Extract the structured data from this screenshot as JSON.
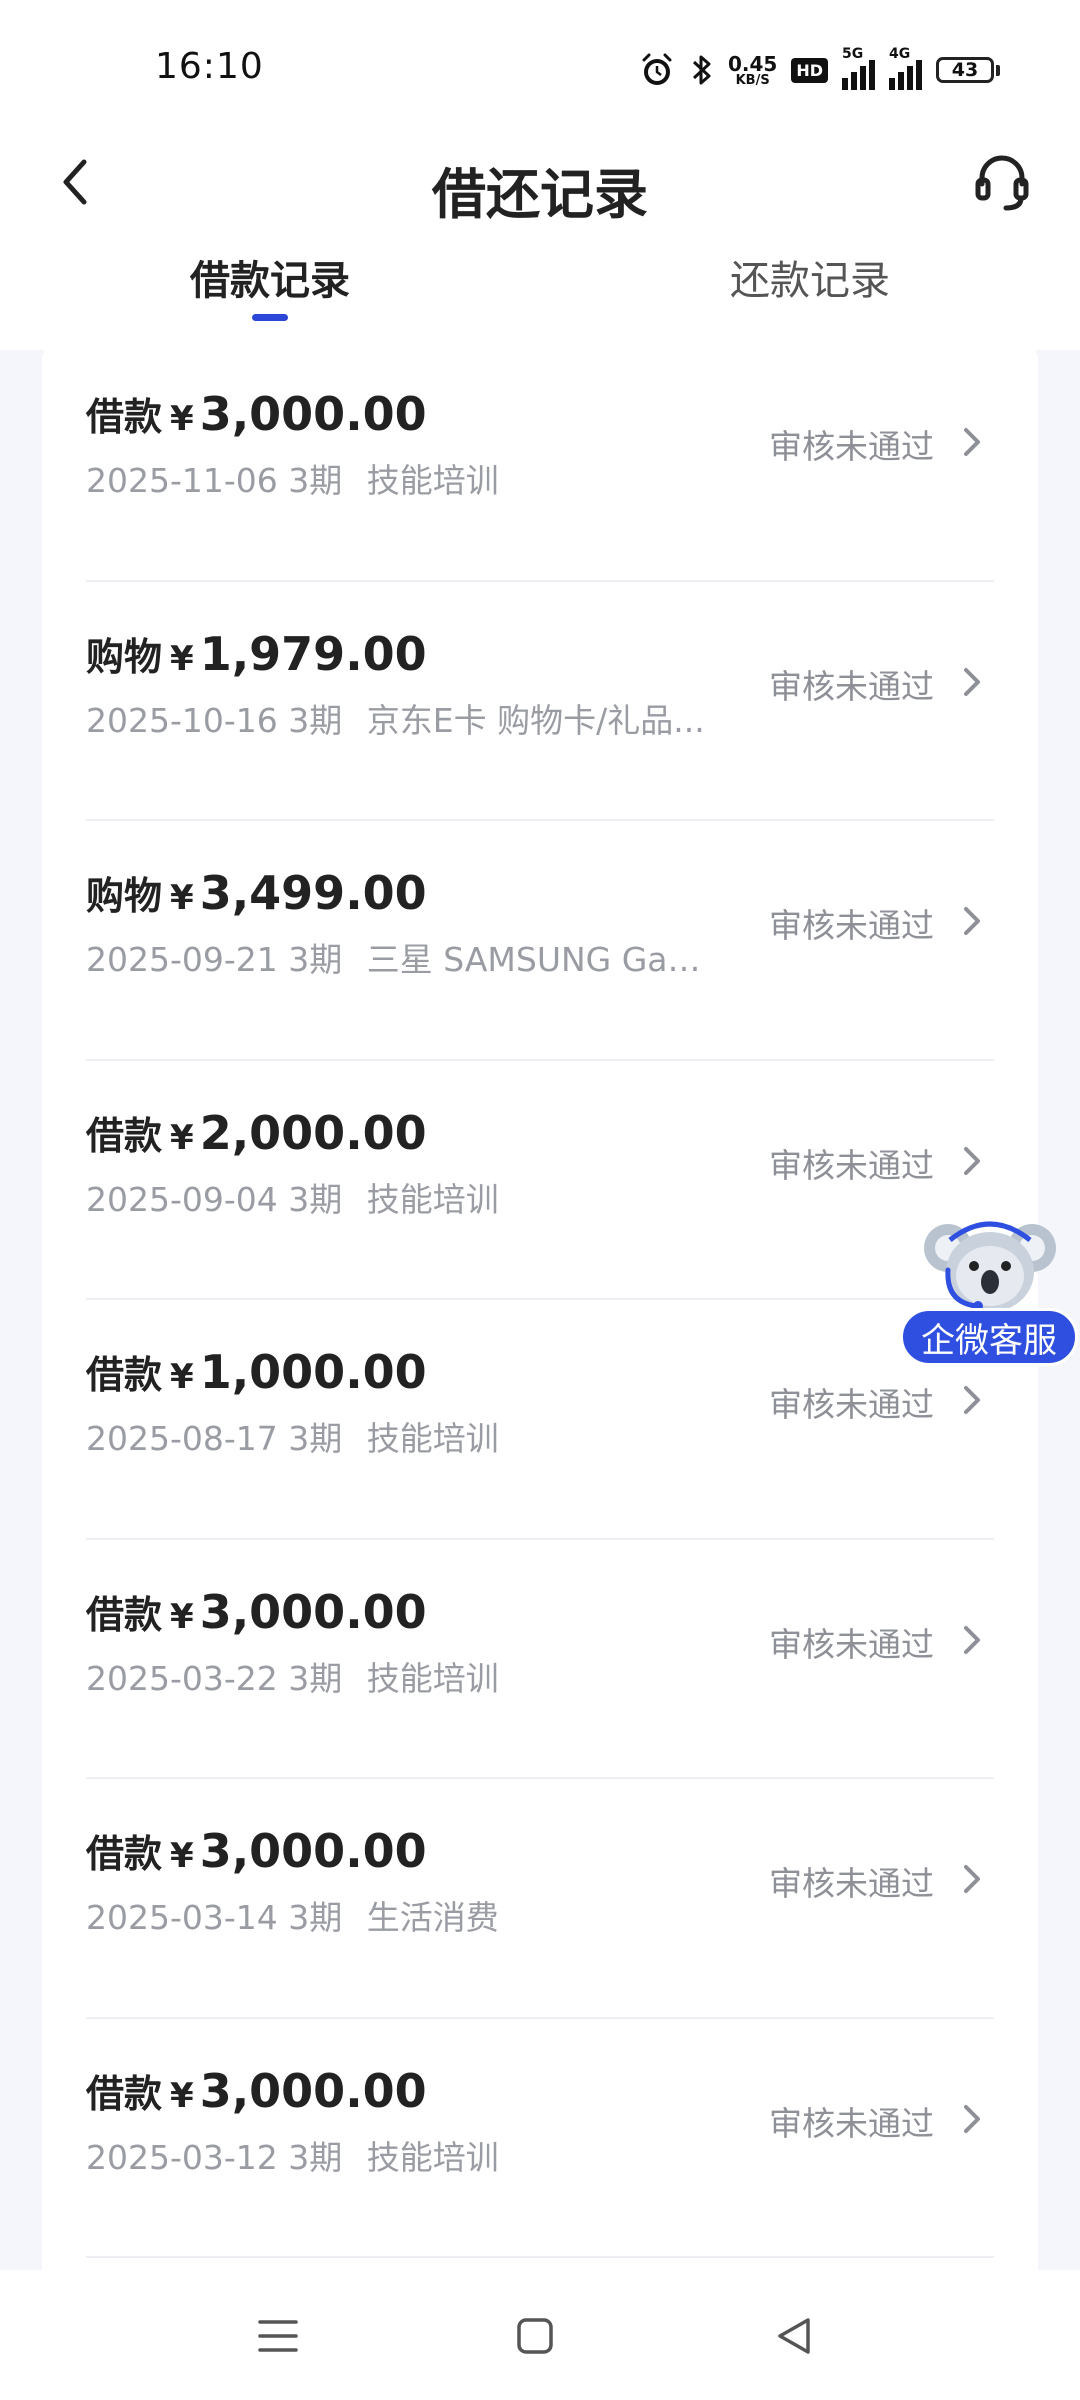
{
  "status_bar": {
    "time": "16:10",
    "net_speed_value": "0.45",
    "net_speed_unit": "KB/S",
    "hd_badge": "HD",
    "signal1_label": "5G",
    "signal2_label": "4G",
    "battery": "43"
  },
  "header": {
    "title": "借还记录",
    "back_icon": "chevron-left-icon",
    "service_icon": "headset-icon"
  },
  "tabs": [
    {
      "label": "借款记录",
      "active": true
    },
    {
      "label": "还款记录",
      "active": false
    }
  ],
  "colors": {
    "accent": "#2c46d8",
    "float_button": "#2f4fe0",
    "status_text": "#8e9097",
    "sub_text": "#9a9ca3"
  },
  "records": [
    {
      "kind": "借款",
      "yen": "¥",
      "amount": "3,000.00",
      "date": "2025-11-06",
      "term": "3期",
      "desc": "技能培训",
      "status": "审核未通过"
    },
    {
      "kind": "购物",
      "yen": "¥",
      "amount": "1,979.00",
      "date": "2025-10-16",
      "term": "3期",
      "desc": "京东E卡 购物卡/礼品...",
      "status": "审核未通过"
    },
    {
      "kind": "购物",
      "yen": "¥",
      "amount": "3,499.00",
      "date": "2025-09-21",
      "term": "3期",
      "desc": "三星 SAMSUNG Galax...",
      "status": "审核未通过"
    },
    {
      "kind": "借款",
      "yen": "¥",
      "amount": "2,000.00",
      "date": "2025-09-04",
      "term": "3期",
      "desc": "技能培训",
      "status": "审核未通过"
    },
    {
      "kind": "借款",
      "yen": "¥",
      "amount": "1,000.00",
      "date": "2025-08-17",
      "term": "3期",
      "desc": "技能培训",
      "status": "审核未通过"
    },
    {
      "kind": "借款",
      "yen": "¥",
      "amount": "3,000.00",
      "date": "2025-03-22",
      "term": "3期",
      "desc": "技能培训",
      "status": "审核未通过"
    },
    {
      "kind": "借款",
      "yen": "¥",
      "amount": "3,000.00",
      "date": "2025-03-14",
      "term": "3期",
      "desc": "生活消费",
      "status": "审核未通过"
    },
    {
      "kind": "借款",
      "yen": "¥",
      "amount": "3,000.00",
      "date": "2025-03-12",
      "term": "3期",
      "desc": "技能培训",
      "status": "审核未通过"
    }
  ],
  "float_service": {
    "label": "企微客服",
    "icon": "koala-mascot-icon"
  },
  "nav_bar": {
    "icons": [
      "menu-icon",
      "home-square-icon",
      "back-triangle-icon"
    ]
  }
}
